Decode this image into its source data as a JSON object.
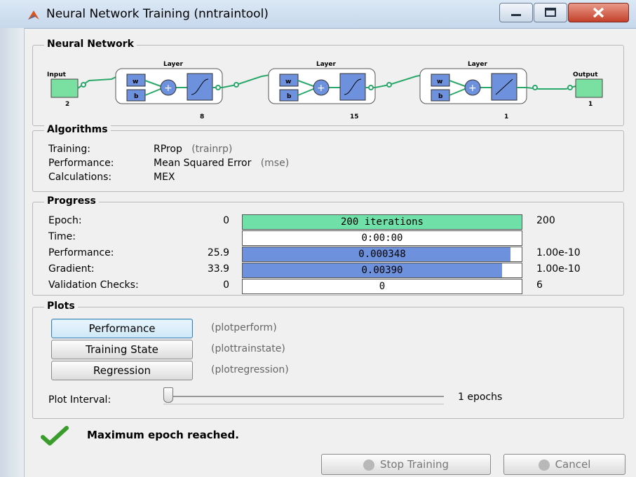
{
  "window": {
    "title": "Neural Network Training (nntraintool)"
  },
  "network": {
    "legend": "Neural Network",
    "input_label": "Input",
    "input_size": "2",
    "output_label": "Output",
    "output_size": "1",
    "layers": [
      {
        "label": "Layer",
        "w": "w",
        "b": "b",
        "size": "8"
      },
      {
        "label": "Layer",
        "w": "w",
        "b": "b",
        "size": "15"
      },
      {
        "label": "Layer",
        "w": "w",
        "b": "b",
        "size": "1"
      }
    ],
    "colors": {
      "io_box": "#79e0a2",
      "transfer_box": "#6e91dd",
      "wire": "#2aa86a"
    }
  },
  "algorithms": {
    "legend": "Algorithms",
    "rows": [
      {
        "label": "Training:",
        "value": "RProp",
        "code": "(trainrp)"
      },
      {
        "label": "Performance:",
        "value": "Mean Squared Error",
        "code": "(mse)"
      },
      {
        "label": "Calculations:",
        "value": "MEX",
        "code": ""
      }
    ]
  },
  "progress": {
    "legend": "Progress",
    "rows": [
      {
        "label": "Epoch:",
        "start": "0",
        "bar_text": "200 iterations",
        "fill": 1.0,
        "color": "#6fe0a8",
        "end": "200"
      },
      {
        "label": "Time:",
        "start": "",
        "bar_text": "0:00:00",
        "fill": 0.0,
        "color": "#6e91dd",
        "end": ""
      },
      {
        "label": "Performance:",
        "start": "25.9",
        "bar_text": "0.000348",
        "fill": 0.96,
        "color": "#6e91dd",
        "end": "1.00e-10"
      },
      {
        "label": "Gradient:",
        "start": "33.9",
        "bar_text": "0.00390",
        "fill": 0.93,
        "color": "#6e91dd",
        "end": "1.00e-10"
      },
      {
        "label": "Validation Checks:",
        "start": "0",
        "bar_text": "0",
        "fill": 0.0,
        "color": "#6e91dd",
        "end": "6"
      }
    ]
  },
  "plots": {
    "legend": "Plots",
    "buttons": [
      {
        "label": "Performance",
        "code": "(plotperform)"
      },
      {
        "label": "Training State",
        "code": "(plottrainstate)"
      },
      {
        "label": "Regression",
        "code": "(plotregression)"
      }
    ],
    "interval_label": "Plot Interval:",
    "interval_value": "1 epochs",
    "slider_position": 0.0
  },
  "status": {
    "message": "Maximum epoch reached.",
    "icon": "check-icon",
    "icon_color": "#3a9d2b"
  },
  "footer": {
    "stop_label": "Stop Training",
    "cancel_label": "Cancel"
  }
}
